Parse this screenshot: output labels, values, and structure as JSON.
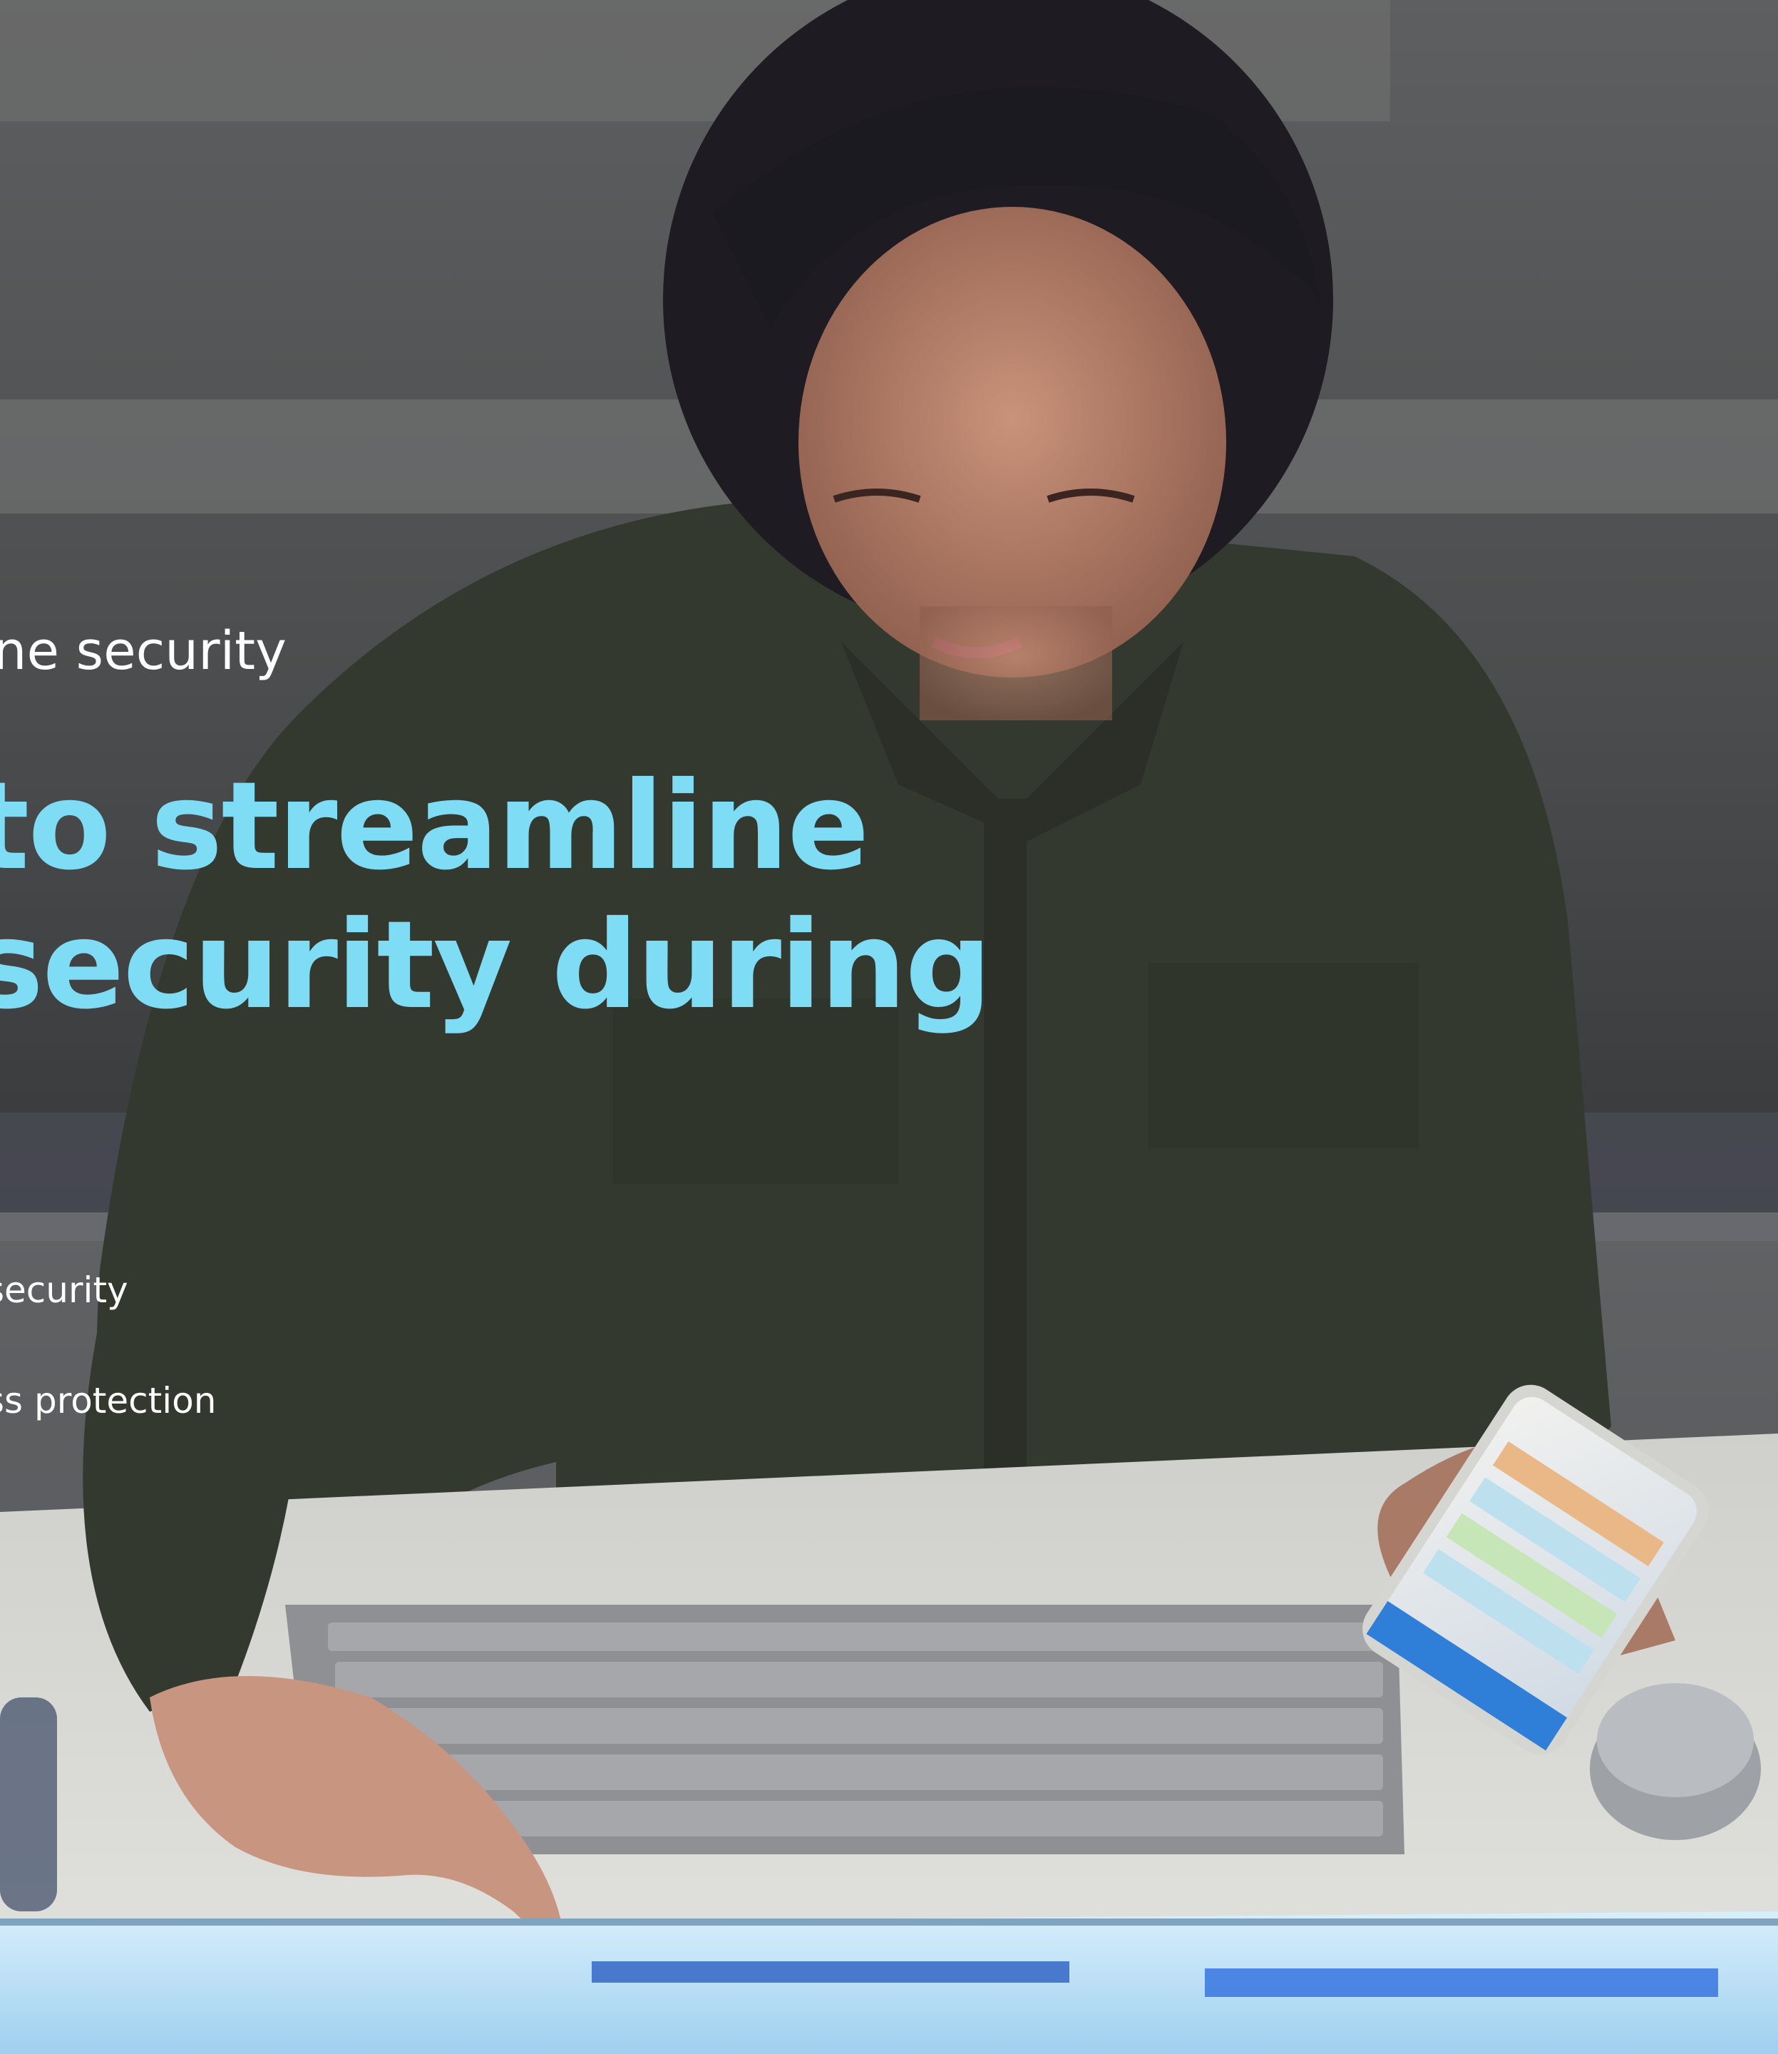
{
  "overlay": {
    "kicker": "ine security",
    "headline_line1": "to streamline",
    "headline_line2": "security during",
    "bullet1": "security",
    "bullet2": "ss protection"
  },
  "colors": {
    "headline": "#7fdcf5",
    "text": "#ffffff",
    "shirt": "#34392f",
    "desk": "#d9d8d4",
    "screen_glow": "#bfe4f8"
  }
}
